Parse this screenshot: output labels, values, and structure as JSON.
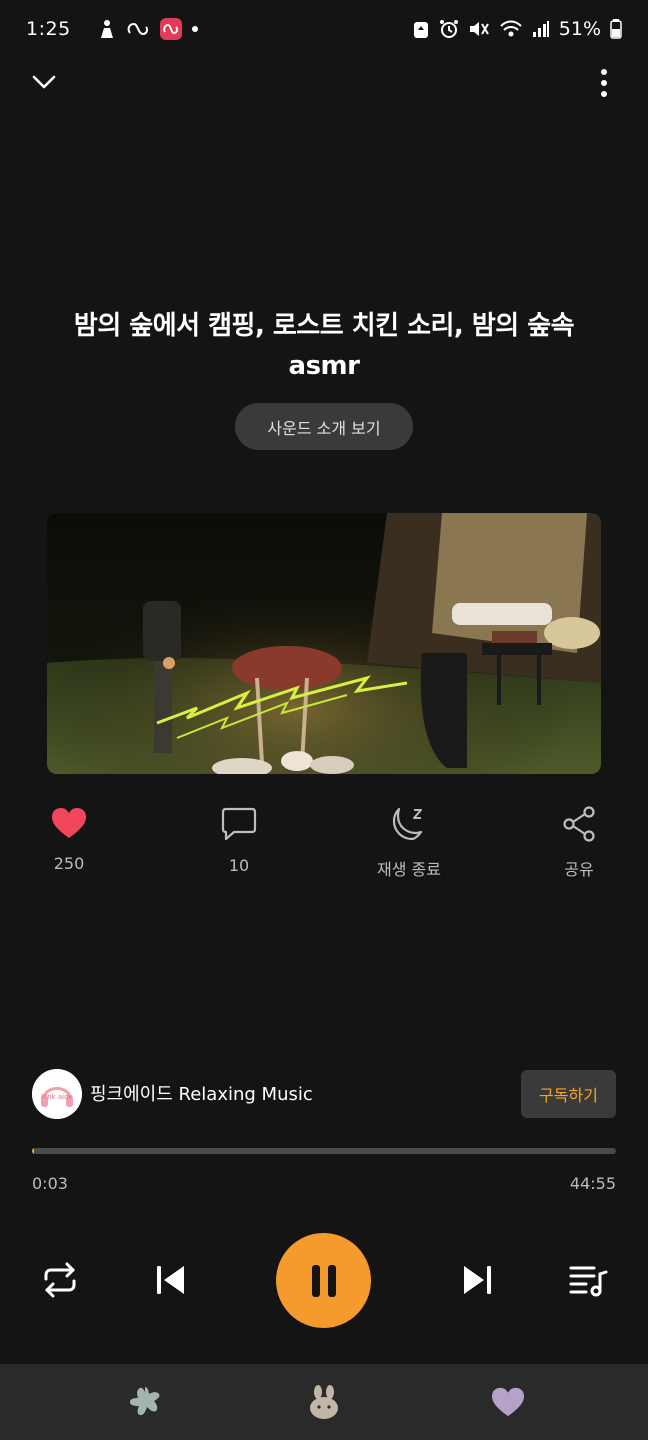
{
  "status_bar": {
    "time": "1:25",
    "battery": "51%",
    "left_icons": [
      "person-icon",
      "loop-icon",
      "app-badge-icon",
      "notification-dot"
    ],
    "right_icons": [
      "recycle-icon",
      "alarm-icon",
      "mute-icon",
      "wifi-icon",
      "signal-icon",
      "battery-icon"
    ]
  },
  "header": {
    "collapse_icon": "chevron-down-icon",
    "more_icon": "more-vertical-icon"
  },
  "track": {
    "title_line1": "밤의 숲에서 캠핑, 로스트 치킨 소리, 밤의 숲속",
    "title_line2": "asmr",
    "intro_button": "사운드 소개 보기"
  },
  "actions": {
    "likes": "250",
    "comments": "10",
    "sleep_timer": "재생 종료",
    "share": "공유"
  },
  "channel": {
    "name": "핑크에이드 Relaxing Music",
    "subscribe_label": "구독하기",
    "avatar_text": "Pink aide"
  },
  "progress": {
    "current": "0:03",
    "total": "44:55",
    "fraction": 0.001
  },
  "controls": {
    "repeat_icon": "repeat-icon",
    "prev_icon": "skip-previous-icon",
    "pause_icon": "pause-icon",
    "next_icon": "skip-next-icon",
    "playlist_icon": "playlist-icon"
  },
  "bottom_nav": {
    "items": [
      "flower-icon",
      "bunny-icon",
      "heart-icon"
    ]
  },
  "colors": {
    "accent": "#f59a2c",
    "like": "#f0475a",
    "background": "#141414",
    "nav_bg": "#2a2a2a"
  }
}
